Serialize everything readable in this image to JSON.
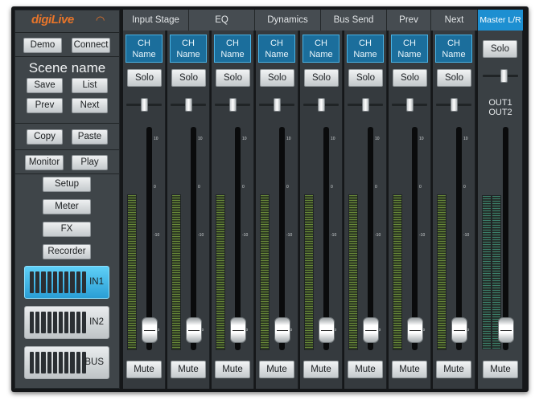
{
  "logo": {
    "text": "digiLive",
    "wifi_icon": "wifi-icon"
  },
  "sidebar": {
    "demo_label": "Demo",
    "connect_label": "Connect",
    "scene_name": "Scene name",
    "save_label": "Save",
    "list_label": "List",
    "prev_label": "Prev",
    "next_label": "Next",
    "copy_label": "Copy",
    "paste_label": "Paste",
    "monitor_label": "Monitor",
    "play_label": "Play",
    "setup_label": "Setup",
    "meter_label": "Meter",
    "fx_label": "FX",
    "recorder_label": "Recorder",
    "sources": [
      {
        "label": "IN1",
        "active": true
      },
      {
        "label": "IN2",
        "active": false
      },
      {
        "label": "BUS",
        "active": false
      }
    ]
  },
  "tabs": [
    "Input Stage",
    "EQ",
    "Dynamics",
    "Bus Send",
    "Prev",
    "Next"
  ],
  "master_tab": "Master L/R",
  "channels": [
    {
      "name": "CH Name",
      "solo": "Solo",
      "mute": "Mute"
    },
    {
      "name": "CH Name",
      "solo": "Solo",
      "mute": "Mute"
    },
    {
      "name": "CH Name",
      "solo": "Solo",
      "mute": "Mute"
    },
    {
      "name": "CH Name",
      "solo": "Solo",
      "mute": "Mute"
    },
    {
      "name": "CH Name",
      "solo": "Solo",
      "mute": "Mute"
    },
    {
      "name": "CH Name",
      "solo": "Solo",
      "mute": "Mute"
    },
    {
      "name": "CH Name",
      "solo": "Solo",
      "mute": "Mute"
    },
    {
      "name": "CH Name",
      "solo": "Solo",
      "mute": "Mute"
    }
  ],
  "master": {
    "solo": "Solo",
    "out1": "OUT1",
    "out2": "OUT2",
    "mute": "Mute"
  },
  "fader_scale": [
    "10",
    "0",
    "-10",
    "-oo"
  ],
  "colors": {
    "accent": "#1d8fd1",
    "brand": "#e8752a",
    "channel_name_bg": "#1b6e9c"
  }
}
